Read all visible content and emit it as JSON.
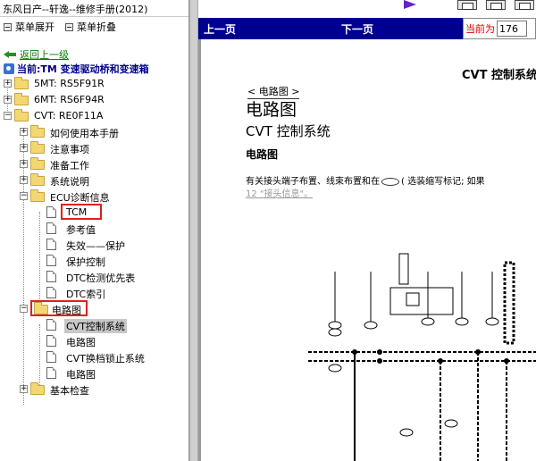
{
  "left": {
    "title": "东风日产--轩逸--维修手册(2012)",
    "expand_all": "菜单展开",
    "collapse_all": "菜单折叠",
    "back": "返回上一级",
    "current": "当前:TM 变速驱动桥和变速箱",
    "tree": {
      "n1": "5MT: RS5F91R",
      "n2": "6MT: RS6F94R",
      "n3": "CVT: RE0F11A",
      "c1": "如何使用本手册",
      "c2": "注意事项",
      "c3": "准备工作",
      "c4": "系统说明",
      "c5": "ECU诊断信息",
      "e1": "TCM",
      "e2": "参考值",
      "e3": "失效——保护",
      "e4": "保护控制",
      "e5": "DTC检测优先表",
      "e6": "DTC索引",
      "c6": "电路图",
      "d1": "CVT控制系统",
      "d2": "电路图",
      "d3": "CVT换档锁止系统",
      "d4": "电路图",
      "c7": "基本检查"
    }
  },
  "nav": {
    "prev": "上一页",
    "next": "下一页",
    "current_label": "当前为",
    "page": "176"
  },
  "doc": {
    "header_right": "CVT 控制系统",
    "breadcrumb": "< 电路图 >",
    "title": "电路图",
    "subtitle": "CVT 控制系统",
    "section": "电路图",
    "para": "有关接头端子布置、线束布置和在",
    "para2": "( 选装缩写标记; 如果",
    "link": "12 \"接头信息\"。"
  },
  "colors": {
    "navbar": "#000090",
    "highlight": "#e02020",
    "folder": "#f3d774"
  }
}
